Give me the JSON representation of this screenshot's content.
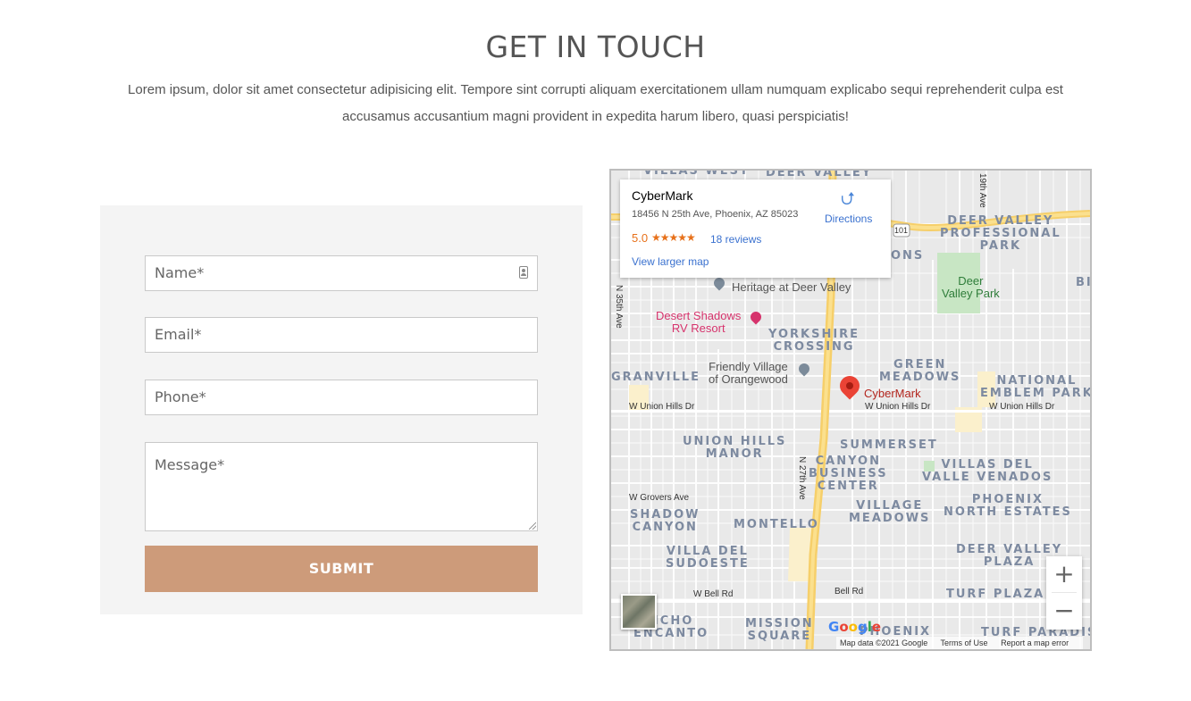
{
  "heading": "GET IN TOUCH",
  "intro": "Lorem ipsum, dolor sit amet consectetur adipisicing elit. Tempore sint corrupti aliquam exercitationem ullam numquam explicabo sequi reprehenderit culpa est accusamus accusantium magni provident in expedita harum libero, quasi perspiciatis!",
  "form": {
    "name_placeholder": "Name*",
    "email_placeholder": "Email*",
    "phone_placeholder": "Phone*",
    "message_placeholder": "Message*",
    "submit_label": "SUBMIT",
    "submit_color": "#cd9b7a"
  },
  "map": {
    "info": {
      "name": "CyberMark",
      "address": "18456 N 25th Ave, Phoenix, AZ 85023",
      "rating": "5.0",
      "stars": "★★★★★",
      "reviews": "18 reviews",
      "view_larger": "View larger map",
      "directions": "Directions"
    },
    "marker_label": "CyberMark",
    "areas": {
      "villas_west": "VILLAS WEST",
      "deer_valley_top": "DEER VALLEY",
      "deer_valley_professional": "DEER VALLEY\nPROFESSIONAL\nPARK",
      "ons": "ONS",
      "yorkshire": "YORKSHIRE\nCROSSING",
      "green_meadows": "GREEN\nMEADOWS",
      "national_emblem": "NATIONAL\nEMBLEM PARK",
      "granville": "GRANVILLE",
      "union_hills_manor": "UNION HILLS\nMANOR",
      "summerset": "SUMMERSET",
      "canyon_business": "CANYON\nBUSINESS\nCENTER",
      "villas_del_valle": "VILLAS DEL\nVALLE VENADOS",
      "phoenix_north": "PHOENIX\nNORTH ESTATES",
      "village_meadows": "VILLAGE\nMEADOWS",
      "shadow_canyon": "SHADOW\nCANYON",
      "montello": "MONTELLO",
      "villa_del_sudoeste": "VILLA DEL\nSUDOESTE",
      "deer_valley_plaza": "DEER VALLEY\nPLAZA",
      "turf_plaza": "TURF PLAZA",
      "rancho_encanto": "NCHO\nENCANTO",
      "mission_square": "MISSION\nSQUARE",
      "phoenix": "PHOENIX",
      "turf_paradise": "TURF PARADIS",
      "bi": "BI"
    },
    "pois": {
      "heritage": "Heritage at Deer Valley",
      "desert_shadows": "Desert Shadows\nRV Resort",
      "friendly_village": "Friendly Village\nof Orangewood",
      "deer_valley_park": "Deer\nValley Park"
    },
    "roads": {
      "union_hills_left": "W Union Hills Dr",
      "union_hills_mid": "W Union Hills Dr",
      "union_hills_right": "W Union Hills Dr",
      "grovers": "W Grovers Ave",
      "bell_left": "W Bell Rd",
      "bell_mid": "Bell Rd",
      "ave_35": "N 35th Ave",
      "ave_27": "N 27th Ave",
      "ave_19": "19th Ave",
      "hwy_101": "101"
    },
    "zoom_in": "+",
    "zoom_out": "−",
    "google": "Google",
    "footer": {
      "data": "Map data ©2021 Google",
      "terms": "Terms of Use",
      "report": "Report a map error"
    }
  }
}
